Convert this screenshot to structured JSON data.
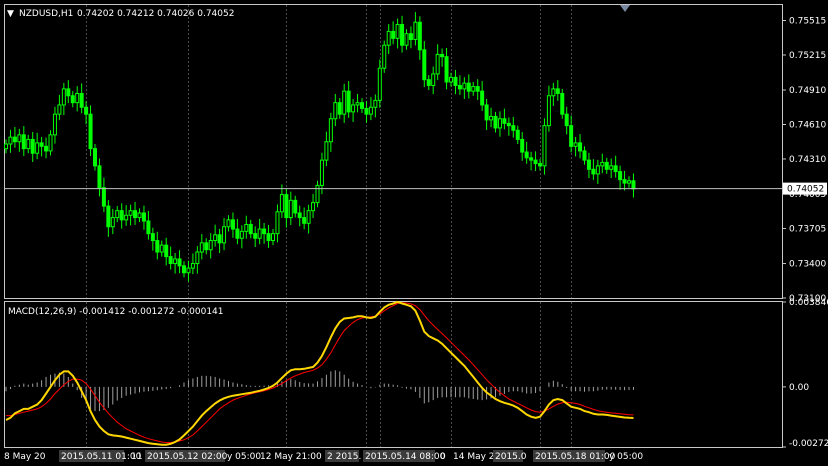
{
  "header": {
    "symbol_label": "NZDUSD,H1",
    "ohlc": "0.74202 0.74212 0.74026 0.74052"
  },
  "macd_header": "MACD(12,26,9) -0.001412 -0.001272 -0.000141",
  "price_axis": {
    "ticks": [
      "0.75515",
      "0.75215",
      "0.74910",
      "0.74610",
      "0.74310",
      "0.74005",
      "0.73705",
      "0.73400",
      "0.73100"
    ],
    "current_price": "0.74052"
  },
  "macd_axis": {
    "ticks": [
      "0.003846",
      "0.00",
      "-0.002725"
    ]
  },
  "time_axis": {
    "labels": [
      {
        "text": "8 May 20",
        "highlighted": false
      },
      {
        "text": "2015.05.11 01:00",
        "highlighted": true
      },
      {
        "text": "11",
        "highlighted": false
      },
      {
        "text": "2015.05.12 02:00",
        "highlighted": true
      },
      {
        "text": "y 05:00",
        "highlighted": false
      },
      {
        "text": "12 May 21:00",
        "highlighted": false
      },
      {
        "text": "2 2015.",
        "highlighted": true
      },
      {
        "text": "2015.05.14 08:00",
        "highlighted": true
      },
      {
        "text": "0",
        "highlighted": false
      },
      {
        "text": "14 May 2",
        "highlighted": false
      },
      {
        "text": "2015.0",
        "highlighted": true
      },
      {
        "text": "2015.05.18 01:00",
        "highlighted": true
      },
      {
        "text": "y 05:00",
        "highlighted": false
      }
    ]
  },
  "colors": {
    "background": "#000000",
    "bull": "#00ff00",
    "bear": "#00ff00",
    "grid": "#4a4a4a",
    "axis": "#c8c8c8",
    "macd_main": "#ffd700",
    "macd_signal": "#ff0000",
    "histogram": "#a0a0a0",
    "text": "#ffffff"
  },
  "chart_data": {
    "type": "candlestick",
    "price_range": [
      0.731,
      0.7565
    ],
    "macd_range": [
      -0.002725,
      0.003846
    ],
    "closes": [
      0.7444,
      0.745,
      0.7446,
      0.7452,
      0.744,
      0.7448,
      0.7436,
      0.7445,
      0.7442,
      0.7438,
      0.7452,
      0.747,
      0.7478,
      0.7492,
      0.7486,
      0.748,
      0.7488,
      0.7476,
      0.747,
      0.744,
      0.7425,
      0.7406,
      0.739,
      0.7372,
      0.738,
      0.7386,
      0.7378,
      0.7382,
      0.7386,
      0.738,
      0.7384,
      0.7377,
      0.7366,
      0.736,
      0.735,
      0.7356,
      0.7346,
      0.734,
      0.7344,
      0.7338,
      0.7332,
      0.7336,
      0.734,
      0.735,
      0.7358,
      0.7352,
      0.736,
      0.7365,
      0.7358,
      0.7372,
      0.7378,
      0.737,
      0.7362,
      0.7368,
      0.7374,
      0.7366,
      0.7362,
      0.737,
      0.7366,
      0.736,
      0.7366,
      0.7385,
      0.74,
      0.738,
      0.7395,
      0.7384,
      0.738,
      0.7375,
      0.7386,
      0.7393,
      0.7408,
      0.743,
      0.7446,
      0.7466,
      0.748,
      0.747,
      0.749,
      0.7472,
      0.7478,
      0.748,
      0.7475,
      0.747,
      0.7476,
      0.7482,
      0.751,
      0.753,
      0.7542,
      0.7536,
      0.7548,
      0.753,
      0.754,
      0.7535,
      0.755,
      0.7526,
      0.75,
      0.7495,
      0.7505,
      0.7522,
      0.752,
      0.7498,
      0.7502,
      0.7495,
      0.7492,
      0.7497,
      0.749,
      0.7494,
      0.749,
      0.7478,
      0.7465,
      0.7468,
      0.7458,
      0.7466,
      0.7462,
      0.746,
      0.7456,
      0.7448,
      0.7437,
      0.7432,
      0.743,
      0.7427,
      0.7425,
      0.746,
      0.7486,
      0.7492,
      0.7488,
      0.747,
      0.746,
      0.7442,
      0.7445,
      0.7438,
      0.743,
      0.7422,
      0.7418,
      0.7425,
      0.7428,
      0.7422,
      0.7425,
      0.742,
      0.7413,
      0.741,
      0.7412,
      0.7405
    ],
    "macd": [
      -0.0015,
      -0.0014,
      -0.0012,
      -0.0011,
      -0.001,
      -0.001,
      -0.0009,
      -0.0008,
      -0.0006,
      -0.0003,
      0.0,
      0.0003,
      0.00055,
      0.0007,
      0.0007,
      0.0005,
      0.0002,
      -0.0002,
      -0.0006,
      -0.0011,
      -0.0015,
      -0.0018,
      -0.002,
      -0.00215,
      -0.0022,
      -0.00222,
      -0.00225,
      -0.0023,
      -0.00235,
      -0.0024,
      -0.00245,
      -0.0025,
      -0.00255,
      -0.00258,
      -0.0026,
      -0.00262,
      -0.00262,
      -0.00258,
      -0.0025,
      -0.00238,
      -0.0022,
      -0.002,
      -0.0018,
      -0.00155,
      -0.0013,
      -0.0011,
      -0.00092,
      -0.00075,
      -0.00062,
      -0.00052,
      -0.00045,
      -0.0004,
      -0.00037,
      -0.00033,
      -0.0003,
      -0.00027,
      -0.00022,
      -0.00018,
      -0.00012,
      -5e-05,
      5e-05,
      0.0002,
      0.0004,
      0.0006,
      0.00075,
      0.0008,
      0.0008,
      0.00082,
      0.00086,
      0.0009,
      0.0011,
      0.0014,
      0.0018,
      0.00225,
      0.00265,
      0.00295,
      0.0031,
      0.00312,
      0.00315,
      0.0032,
      0.0032,
      0.00315,
      0.00312,
      0.00318,
      0.0034,
      0.0036,
      0.00372,
      0.00378,
      0.00385,
      0.00378,
      0.00372,
      0.00365,
      0.00345,
      0.003,
      0.0025,
      0.0023,
      0.0022,
      0.0021,
      0.00195,
      0.00175,
      0.00155,
      0.00135,
      0.00115,
      0.00095,
      0.0007,
      0.00045,
      0.0002,
      -5e-05,
      -0.00025,
      -0.0004,
      -0.00055,
      -0.00065,
      -0.00072,
      -0.00078,
      -0.00085,
      -0.00095,
      -0.0011,
      -0.00125,
      -0.00135,
      -0.0014,
      -0.00135,
      -0.0011,
      -0.0008,
      -0.0006,
      -0.00055,
      -0.0006,
      -0.00075,
      -0.0009,
      -0.00095,
      -0.001,
      -0.0011,
      -0.00115,
      -0.00122,
      -0.00125,
      -0.00125,
      -0.00127,
      -0.0013,
      -0.00133,
      -0.00136,
      -0.00139,
      -0.0014,
      -0.00141
    ],
    "signal": [
      -0.0013,
      -0.0013,
      -0.00125,
      -0.0012,
      -0.00115,
      -0.0011,
      -0.00105,
      -0.001,
      -0.0009,
      -0.00075,
      -0.00055,
      -0.0003,
      -0.0001,
      0.0001,
      0.00025,
      0.00035,
      0.00035,
      0.0003,
      0.00015,
      -0.0001,
      -0.0004,
      -0.0007,
      -0.00095,
      -0.0012,
      -0.0014,
      -0.0016,
      -0.00175,
      -0.0019,
      -0.002,
      -0.0021,
      -0.0022,
      -0.00228,
      -0.00235,
      -0.0024,
      -0.00245,
      -0.0025,
      -0.00252,
      -0.00252,
      -0.0025,
      -0.00245,
      -0.0024,
      -0.0023,
      -0.00218,
      -0.002,
      -0.0018,
      -0.0016,
      -0.0014,
      -0.0012,
      -0.001,
      -0.00085,
      -0.00072,
      -0.0006,
      -0.00052,
      -0.00045,
      -0.00038,
      -0.00032,
      -0.00027,
      -0.00023,
      -0.00018,
      -0.00012,
      -5e-05,
      5e-05,
      0.00015,
      0.00028,
      0.0004,
      0.0005,
      0.00058,
      0.00065,
      0.0007,
      0.00075,
      0.00085,
      0.001,
      0.00125,
      0.00155,
      0.0019,
      0.00225,
      0.00255,
      0.00275,
      0.00292,
      0.00305,
      0.00312,
      0.00315,
      0.00318,
      0.0032,
      0.0033,
      0.00345,
      0.00358,
      0.00368,
      0.00378,
      0.00382,
      0.0038,
      0.00376,
      0.00368,
      0.0035,
      0.00325,
      0.003,
      0.0028,
      0.0026,
      0.00242,
      0.00222,
      0.00202,
      0.00182,
      0.00162,
      0.00142,
      0.00122,
      0.001,
      0.00078,
      0.00055,
      0.00032,
      0.00012,
      -8e-05,
      -0.00025,
      -0.0004,
      -0.00055,
      -0.00065,
      -0.00075,
      -0.00085,
      -0.00095,
      -0.00105,
      -0.00112,
      -0.00115,
      -0.0011,
      -0.001,
      -0.00088,
      -0.00078,
      -0.00072,
      -0.0007,
      -0.00072,
      -0.00075,
      -0.0008,
      -0.00088,
      -0.00095,
      -0.00102,
      -0.00108,
      -0.00112,
      -0.00115,
      -0.00118,
      -0.0012,
      -0.00122,
      -0.00124,
      -0.00126,
      -0.00127
    ]
  }
}
